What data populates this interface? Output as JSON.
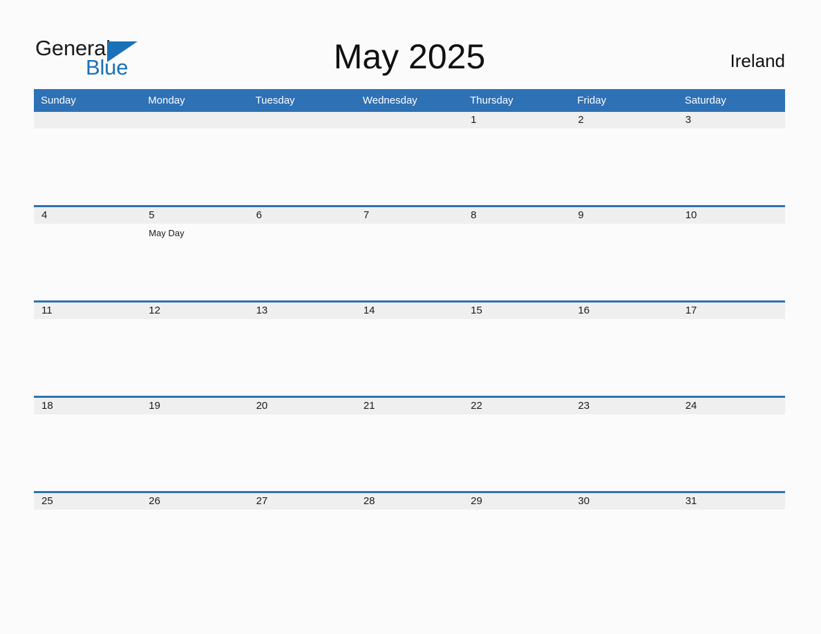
{
  "brand": {
    "logo_text_primary": "General",
    "logo_text_secondary": "Blue",
    "logo_color_primary": "#1a1a1a",
    "logo_color_secondary": "#1a71b8"
  },
  "header": {
    "title": "May 2025",
    "country": "Ireland"
  },
  "theme": {
    "header_blue": "#2e71b5",
    "row_stripe": "#efefef",
    "page_background": "#fbfbfb",
    "text": "#1a1a1a"
  },
  "weekdays": [
    "Sunday",
    "Monday",
    "Tuesday",
    "Wednesday",
    "Thursday",
    "Friday",
    "Saturday"
  ],
  "weeks": [
    {
      "days": [
        {
          "num": "",
          "events": []
        },
        {
          "num": "",
          "events": []
        },
        {
          "num": "",
          "events": []
        },
        {
          "num": "",
          "events": []
        },
        {
          "num": "1",
          "events": []
        },
        {
          "num": "2",
          "events": []
        },
        {
          "num": "3",
          "events": []
        }
      ]
    },
    {
      "days": [
        {
          "num": "4",
          "events": []
        },
        {
          "num": "5",
          "events": [
            "May Day"
          ]
        },
        {
          "num": "6",
          "events": []
        },
        {
          "num": "7",
          "events": []
        },
        {
          "num": "8",
          "events": []
        },
        {
          "num": "9",
          "events": []
        },
        {
          "num": "10",
          "events": []
        }
      ]
    },
    {
      "days": [
        {
          "num": "11",
          "events": []
        },
        {
          "num": "12",
          "events": []
        },
        {
          "num": "13",
          "events": []
        },
        {
          "num": "14",
          "events": []
        },
        {
          "num": "15",
          "events": []
        },
        {
          "num": "16",
          "events": []
        },
        {
          "num": "17",
          "events": []
        }
      ]
    },
    {
      "days": [
        {
          "num": "18",
          "events": []
        },
        {
          "num": "19",
          "events": []
        },
        {
          "num": "20",
          "events": []
        },
        {
          "num": "21",
          "events": []
        },
        {
          "num": "22",
          "events": []
        },
        {
          "num": "23",
          "events": []
        },
        {
          "num": "24",
          "events": []
        }
      ]
    },
    {
      "days": [
        {
          "num": "25",
          "events": []
        },
        {
          "num": "26",
          "events": []
        },
        {
          "num": "27",
          "events": []
        },
        {
          "num": "28",
          "events": []
        },
        {
          "num": "29",
          "events": []
        },
        {
          "num": "30",
          "events": []
        },
        {
          "num": "31",
          "events": []
        }
      ]
    }
  ]
}
